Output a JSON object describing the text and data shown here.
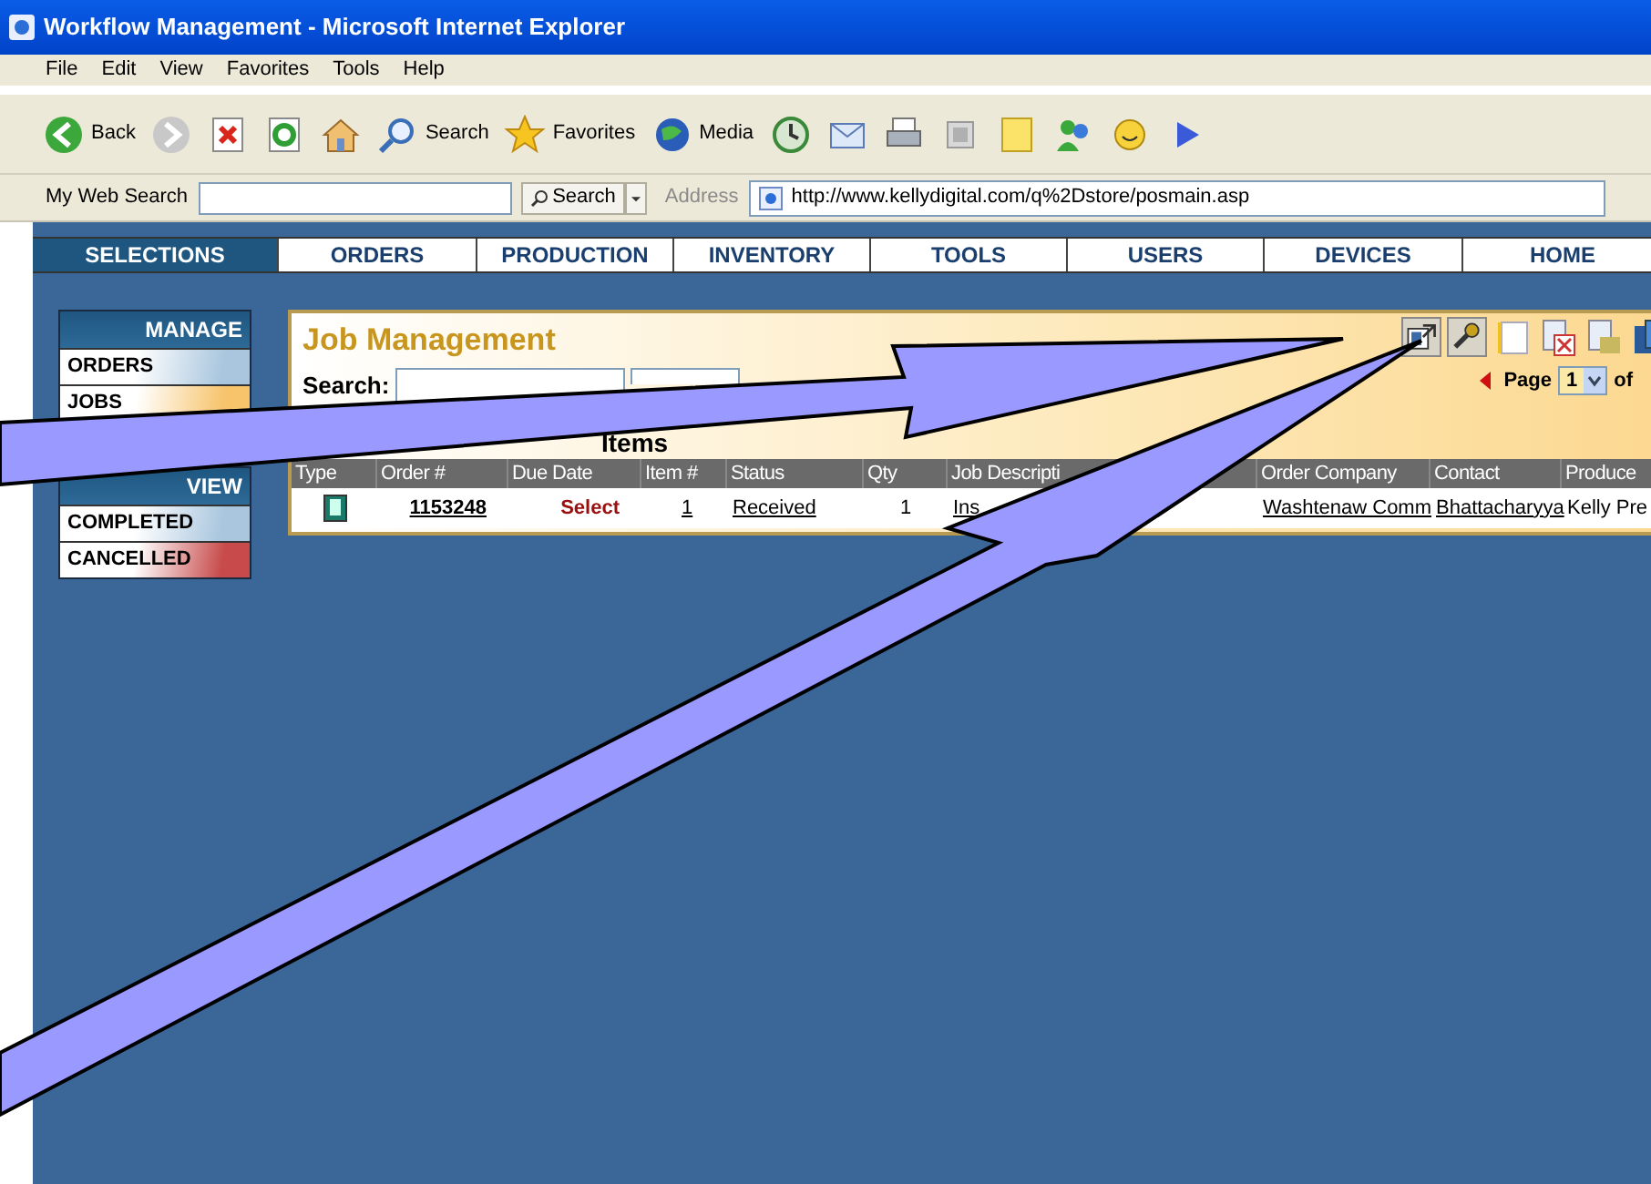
{
  "window": {
    "title": "Workflow Management - Microsoft Internet Explorer"
  },
  "menu": [
    "File",
    "Edit",
    "View",
    "Favorites",
    "Tools",
    "Help"
  ],
  "toolbar": [
    {
      "kind": "back",
      "label": "Back"
    },
    {
      "kind": "forward"
    },
    {
      "kind": "stop"
    },
    {
      "kind": "refresh"
    },
    {
      "kind": "home"
    },
    {
      "kind": "search",
      "label": "Search"
    },
    {
      "kind": "favorites",
      "label": "Favorites"
    },
    {
      "kind": "media",
      "label": "Media"
    },
    {
      "kind": "history"
    },
    {
      "kind": "mail"
    },
    {
      "kind": "print"
    },
    {
      "kind": "edit"
    },
    {
      "kind": "note"
    },
    {
      "kind": "messenger"
    },
    {
      "kind": "smiley"
    },
    {
      "kind": "play"
    }
  ],
  "web_search": {
    "label": "My Web Search",
    "button": "Search"
  },
  "address": {
    "label": "Address",
    "value": "http://www.kellydigital.com/q%2Dstore/posmain.asp"
  },
  "nav_tabs": [
    {
      "label": "SELECTIONS",
      "selected": true
    },
    {
      "label": "ORDERS",
      "selected": false
    },
    {
      "label": "PRODUCTION",
      "selected": false
    },
    {
      "label": "INVENTORY",
      "selected": false
    },
    {
      "label": "TOOLS",
      "selected": false
    },
    {
      "label": "USERS",
      "selected": false
    },
    {
      "label": "DEVICES",
      "selected": false
    },
    {
      "label": "HOME",
      "selected": false
    }
  ],
  "sidebar": [
    {
      "title": "MANAGE",
      "items": [
        {
          "label": "ORDERS",
          "color": "#a9c6de"
        },
        {
          "label": "JOBS",
          "color": "#f7c46c"
        }
      ]
    },
    {
      "title": "VIEW",
      "items": [
        {
          "label": "COMPLETED",
          "color": "#a9c6de"
        },
        {
          "label": "CANCELLED",
          "color": "#c84a4a"
        }
      ]
    }
  ],
  "panel": {
    "title": "Job Management",
    "search_label": "Search:",
    "tools": [
      {
        "kind": "export"
      },
      {
        "kind": "wrench"
      },
      {
        "kind": "note"
      },
      {
        "kind": "delete"
      },
      {
        "kind": "edit"
      },
      {
        "kind": "copy"
      }
    ],
    "pager": {
      "label": "Page",
      "value": "1",
      "total": "of"
    },
    "section_title": "Items"
  },
  "table": {
    "columns": [
      "Type",
      "Order #",
      "Due Date",
      "Item #",
      "Status",
      "Qty",
      "Job Descripti",
      "Order Company",
      "Contact",
      "Produce"
    ],
    "rows": [
      {
        "cells": [
          {
            "kind": "icon"
          },
          {
            "kind": "bold_link",
            "text": "1153248"
          },
          {
            "kind": "action",
            "text": "Select"
          },
          {
            "kind": "link",
            "text": "1"
          },
          {
            "kind": "link",
            "text": "Received"
          },
          {
            "kind": "plain",
            "text": "1"
          },
          {
            "kind": "link",
            "text": "Ins"
          },
          {
            "kind": "link",
            "text": "Washtenaw Comm"
          },
          {
            "kind": "link",
            "text": "Bhattacharyya"
          },
          {
            "kind": "plain",
            "text": "Kelly Pre"
          }
        ]
      }
    ]
  }
}
